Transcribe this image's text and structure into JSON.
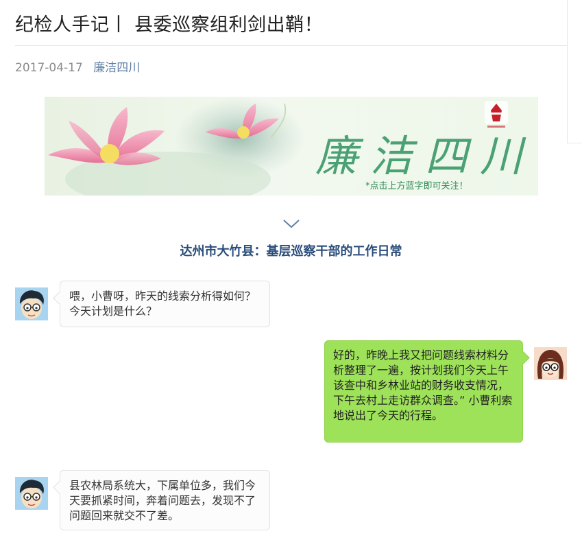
{
  "article": {
    "title": "纪检人手记丨 县委巡察组利剑出鞘！",
    "date": "2017-04-17",
    "account": "廉洁四川"
  },
  "banner": {
    "brand_text": "廉洁四川",
    "caption": "*点击上方蓝字即可关注！"
  },
  "section": {
    "heading": "达州市大竹县：基层巡察干部的工作日常"
  },
  "messages": [
    {
      "side": "left",
      "speaker": "male",
      "text": "喂，小曹呀，昨天的线索分析得如何？今天计划是什么？"
    },
    {
      "side": "right",
      "speaker": "female",
      "text": "好的，昨晚上我又把问题线索材料分析整理了一遍，按计划我们今天上午该查中和乡林业站的财务收支情况，下午去村上走访群众调查。” 小曹利索地说出了今天的行程。"
    },
    {
      "side": "left",
      "speaker": "male",
      "text": "县农林局系统大，下属单位多，我们今天要抓紧时间，奔着问题去，发现不了问题回来就交不了差。"
    }
  ],
  "colors": {
    "accent": "#607fa6",
    "heading": "#2a4d7a",
    "bubble_right": "#9ee25a",
    "bubble_left": "#fcfcfc"
  },
  "icons": {
    "chevron": "chevron-down-icon",
    "male_avatar": "male-avatar-icon",
    "female_avatar": "female-avatar-icon"
  }
}
